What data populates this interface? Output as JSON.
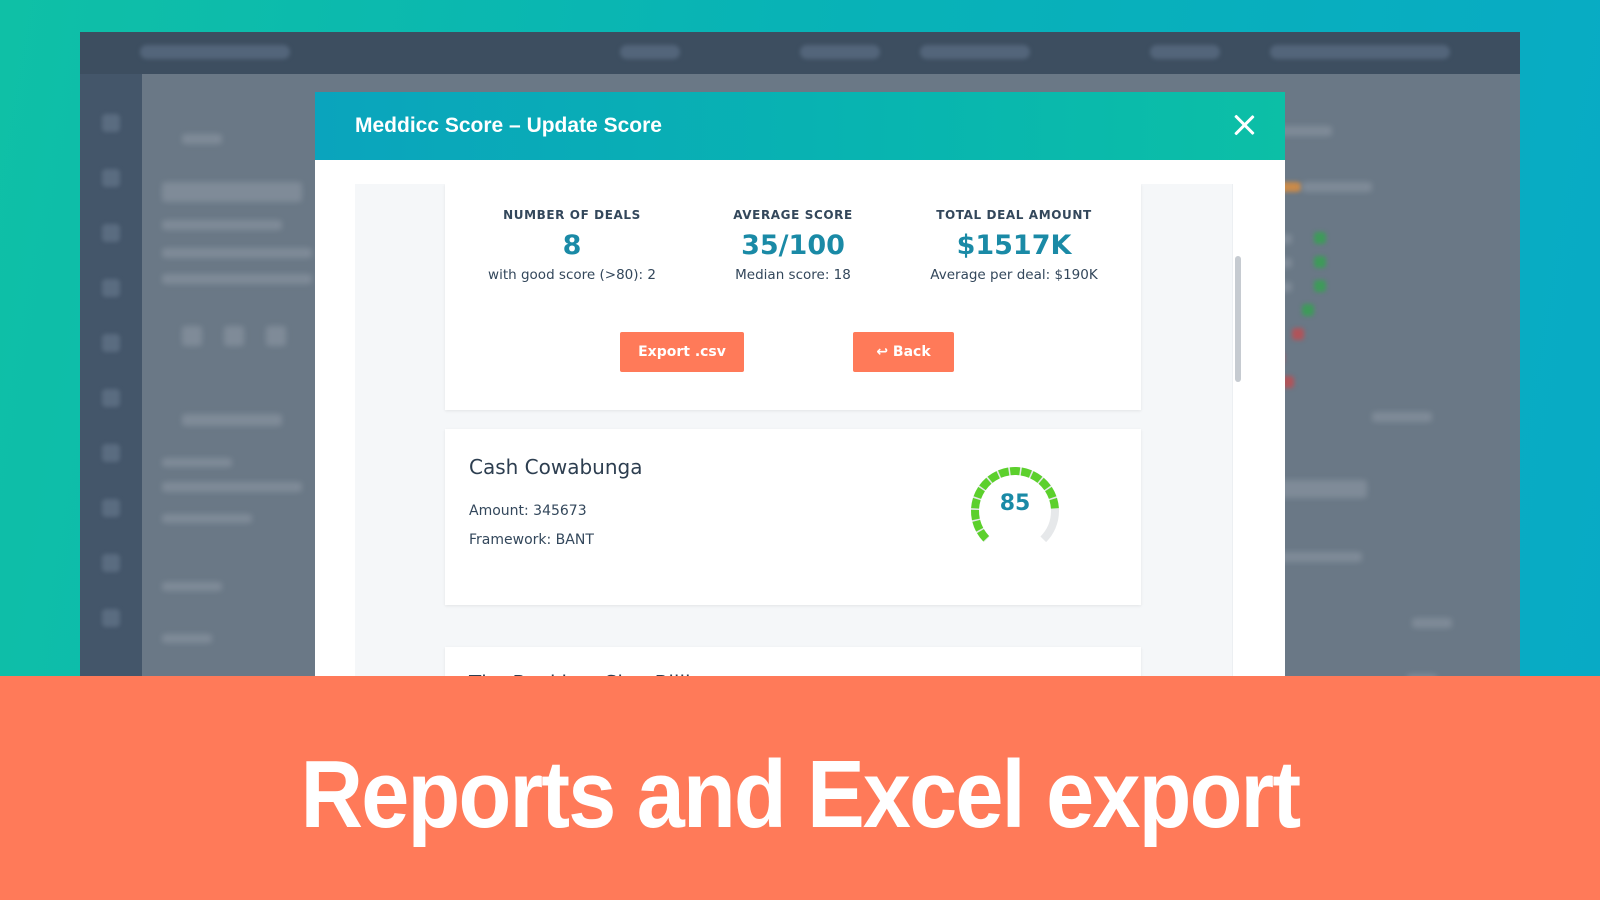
{
  "modal": {
    "title": "Meddicc Score – Update Score",
    "close_icon": "close-icon"
  },
  "summary": {
    "stats": [
      {
        "label": "NUMBER OF DEALS",
        "value": "8",
        "sub": "with good score (>80): 2"
      },
      {
        "label": "AVERAGE SCORE",
        "value": "35/100",
        "sub": "Median score: 18"
      },
      {
        "label": "TOTAL DEAL AMOUNT",
        "value": "$1517K",
        "sub": "Average per deal: $190K"
      }
    ],
    "export_label": "Export .csv",
    "back_label": "↩ Back"
  },
  "deals": [
    {
      "name": "Cash Cowabunga",
      "amount_text": "Amount: 345673",
      "framework_text": "Framework: BANT",
      "score": "85",
      "score_fraction": 0.85
    },
    {
      "name": "The Buckboy Sign Billion"
    }
  ],
  "banner": {
    "text": "Reports and Excel export"
  },
  "colors": {
    "accent_teal": "#1a8aa6",
    "button_orange": "#ff7a59",
    "gauge_green": "#5cd02c",
    "gauge_track": "#e6e8ea"
  }
}
